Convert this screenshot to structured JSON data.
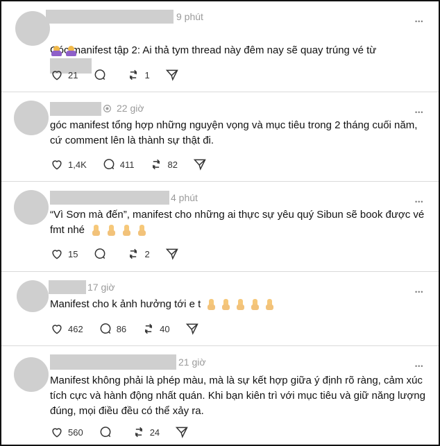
{
  "posts": [
    {
      "time": "9 phút",
      "text_line1": "Góc manifest tập 2: Ai thả tym thread này đêm nay sẽ quay trúng vé từ",
      "emoji": [
        "🙏",
        "🙏"
      ],
      "likes": "21",
      "comments": "",
      "reposts": "1"
    },
    {
      "time": "22 giờ",
      "text": "góc manifest tổng hợp những nguyện vọng và mục tiêu trong 2 tháng cuối năm,\ncứ comment lên là thành sự thật đi.",
      "likes": "1,4K",
      "comments": "411",
      "reposts": "82"
    },
    {
      "time": "4 phút",
      "text": "“Vì Sơn mà đến”, manifest cho những ai thực sự yêu quý Sibun sẽ book được vé\nfmt nhé",
      "emoji": [
        "🤞",
        "🤞",
        "🤞",
        "🤞"
      ],
      "likes": "15",
      "comments": "",
      "reposts": "2"
    },
    {
      "time": "17 giờ",
      "text": "Manifest cho k ảnh hưởng tới e t",
      "emoji": [
        "🤞",
        "🤞",
        "🤞",
        "🤞",
        "🤞"
      ],
      "likes": "462",
      "comments": "86",
      "reposts": "40"
    },
    {
      "time": "21 giờ",
      "text": "Manifest không phải là phép màu, mà là sự kết hợp giữa ý định rõ ràng, cảm xúc\ntích cực và hành động nhất quán. Khi bạn kiên trì với mục tiêu và giữ năng lượng\nđúng, mọi điều đều có thể xảy ra.",
      "likes": "560",
      "comments": "",
      "reposts": "24"
    }
  ],
  "icons": {
    "like": "heart-icon",
    "comment": "comment-bubble-icon",
    "repost": "repost-icon",
    "share": "send-icon",
    "more": "more-dots-icon",
    "verified": "badge-icon"
  }
}
